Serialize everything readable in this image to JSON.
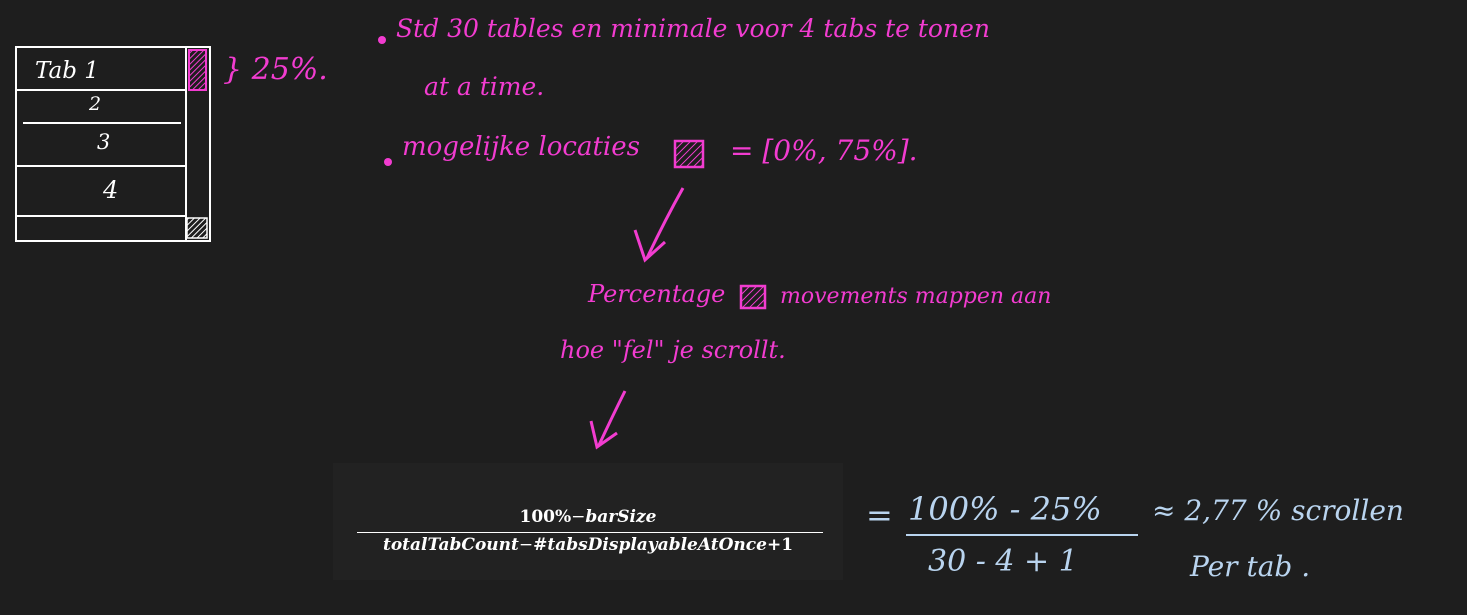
{
  "tab_widget": {
    "tabs": [
      "Tab 1",
      "2",
      "3",
      "4"
    ],
    "bar_size_label": "} 25%."
  },
  "notes": {
    "line1": "Std 30 tables en minimale voor 4 tabs te tonen",
    "line2": "at a time.",
    "line3": "mogelijke locaties",
    "line3_range": "= [0%, 75%].",
    "line4": "Percentage",
    "line4_rest": "movements mappen aan",
    "line5": "hoe \"fel\" je scrollt."
  },
  "formula": {
    "numerator_pct": "100%",
    "numerator_minus": "−",
    "numerator_var": "barSize",
    "denominator_var1": "totalTabCount",
    "denominator_minus": "−",
    "denominator_var2": "#tabsDisplayableAtOnce",
    "denominator_plus": "+1"
  },
  "result": {
    "equals": "=",
    "numerator": "100% - 25%",
    "denominator": "30 - 4 + 1",
    "approx": "≈ 2,77 % scrollen",
    "per_tab": "Per tab ."
  },
  "colors": {
    "background": "#1e1e1e",
    "pink": "#f23cd0",
    "blue": "#b9d4ef",
    "white": "#ffffff"
  }
}
